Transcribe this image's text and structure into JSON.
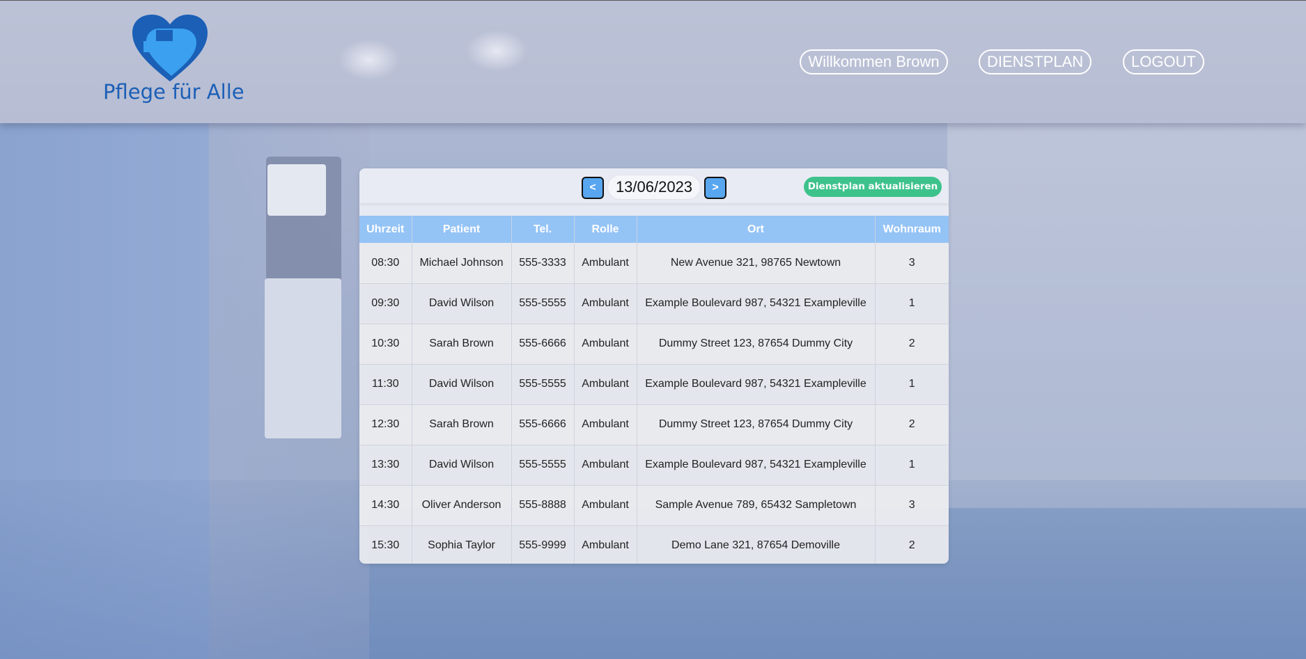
{
  "header": {
    "logo_text": "Pflege für Alle",
    "nav": {
      "welcome": "Willkommen Brown",
      "dienstplan": "DIENSTPLAN",
      "logout": "LOGOUT"
    }
  },
  "schedule": {
    "prev_label": "<",
    "next_label": ">",
    "date": "13/06/2023",
    "update_label": "Dienstplan aktualisieren",
    "columns": [
      "Uhrzeit",
      "Patient",
      "Tel.",
      "Rolle",
      "Ort",
      "Wohnraum"
    ],
    "rows": [
      [
        "08:30",
        "Michael Johnson",
        "555-3333",
        "Ambulant",
        "New Avenue 321, 98765 Newtown",
        "3"
      ],
      [
        "09:30",
        "David Wilson",
        "555-5555",
        "Ambulant",
        "Example Boulevard 987, 54321 Exampleville",
        "1"
      ],
      [
        "10:30",
        "Sarah Brown",
        "555-6666",
        "Ambulant",
        "Dummy Street 123, 87654 Dummy City",
        "2"
      ],
      [
        "11:30",
        "David Wilson",
        "555-5555",
        "Ambulant",
        "Example Boulevard 987, 54321 Exampleville",
        "1"
      ],
      [
        "12:30",
        "Sarah Brown",
        "555-6666",
        "Ambulant",
        "Dummy Street 123, 87654 Dummy City",
        "2"
      ],
      [
        "13:30",
        "David Wilson",
        "555-5555",
        "Ambulant",
        "Example Boulevard 987, 54321 Exampleville",
        "1"
      ],
      [
        "14:30",
        "Oliver Anderson",
        "555-8888",
        "Ambulant",
        "Sample Avenue 789, 65432 Sampletown",
        "3"
      ],
      [
        "15:30",
        "Sophia Taylor",
        "555-9999",
        "Ambulant",
        "Demo Lane 321, 87654 Demoville",
        "2"
      ]
    ]
  },
  "colors": {
    "brand_blue": "#1b5fb6",
    "header_th": "#94c3f6",
    "accent_green": "#3ec28c",
    "nav_button": "#58a6ef"
  }
}
